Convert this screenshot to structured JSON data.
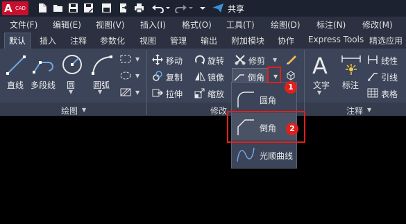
{
  "app": {
    "logo_letter": "A",
    "logo_sub": "CAD",
    "share_label": "共享"
  },
  "menu": [
    "文件(F)",
    "编辑(E)",
    "视图(V)",
    "插入(I)",
    "格式(O)",
    "工具(T)",
    "绘图(D)",
    "标注(N)",
    "修改(M)"
  ],
  "tabs": [
    "默认",
    "插入",
    "注释",
    "参数化",
    "视图",
    "管理",
    "输出",
    "附加模块",
    "协作",
    "Express Tools",
    "精选应用"
  ],
  "draw_panel": {
    "title": "绘图",
    "tools": [
      "直线",
      "多段线",
      "圆",
      "圆弧"
    ]
  },
  "modify_panel": {
    "title": "修改",
    "tools": [
      "移动",
      "旋转",
      "修剪",
      "复制",
      "镜像",
      "倒角",
      "拉伸",
      "缩放"
    ]
  },
  "annotate_panel": {
    "title": "注释",
    "tools": [
      "文字",
      "标注",
      "线性",
      "引线",
      "表格"
    ]
  },
  "dropdown": {
    "items": [
      "圆角",
      "倒角",
      "光顺曲线"
    ],
    "selected": "倒角"
  },
  "badges": [
    "1",
    "2"
  ],
  "colors": {
    "accent_red": "#e0201c",
    "ribbon_bg": "#3b4458",
    "logo_red": "#c8102e"
  }
}
